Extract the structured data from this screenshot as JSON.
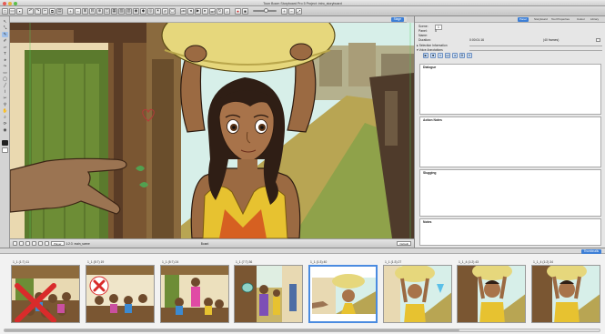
{
  "window": {
    "title": "Toon Boom Storyboard Pro 5 Project: intro_storyboard"
  },
  "stage": {
    "view_tab": "Stage",
    "layer_label": "Player",
    "field": "1:2:3",
    "layer_name": "main_scene",
    "mode_label": "Board",
    "zoom_label": "Default"
  },
  "right_panel": {
    "tabs": [
      "Panel",
      "Storyboard",
      "Tool Properties",
      "Colour",
      "Library"
    ],
    "active_tab": "Panel",
    "scene_label": "Scene:",
    "scene_value": "1",
    "panel_label": "Panel:",
    "panel_value": "5",
    "name_label": "Name:",
    "duration_label": "Duration:",
    "duration_value": "0:00:01:16",
    "duration_frames": "(40 frames)",
    "selection_info": "Selection Information",
    "voice_annotations": "Voice Annotations",
    "sections": [
      "Dialogue",
      "Action Notes",
      "Slugging",
      "Notes"
    ]
  },
  "thumbnails_bar": {
    "tab": "Thumbnails"
  },
  "thumbnails": [
    {
      "label": "1_1 (1:7) 11"
    },
    {
      "label": "1_1 (5:7) 19"
    },
    {
      "label": "1_1 (5:7) 24"
    },
    {
      "label": "1_1 (7:7) 36"
    },
    {
      "label": "1_1 (1:3) 40"
    },
    {
      "label": "1_1 (1:3) 27"
    },
    {
      "label": "1_1_4 (1:2) 43"
    },
    {
      "label": "1_1_4 (1:2) 34"
    }
  ],
  "colors": {
    "accent": "#3d7fd6",
    "sky": "#d7efe9",
    "skin": "#9b6a42",
    "dress": "#e7c230",
    "pot": "#e6d77c",
    "hair": "#2f1e15",
    "reject_mark": "#d92b2b"
  }
}
